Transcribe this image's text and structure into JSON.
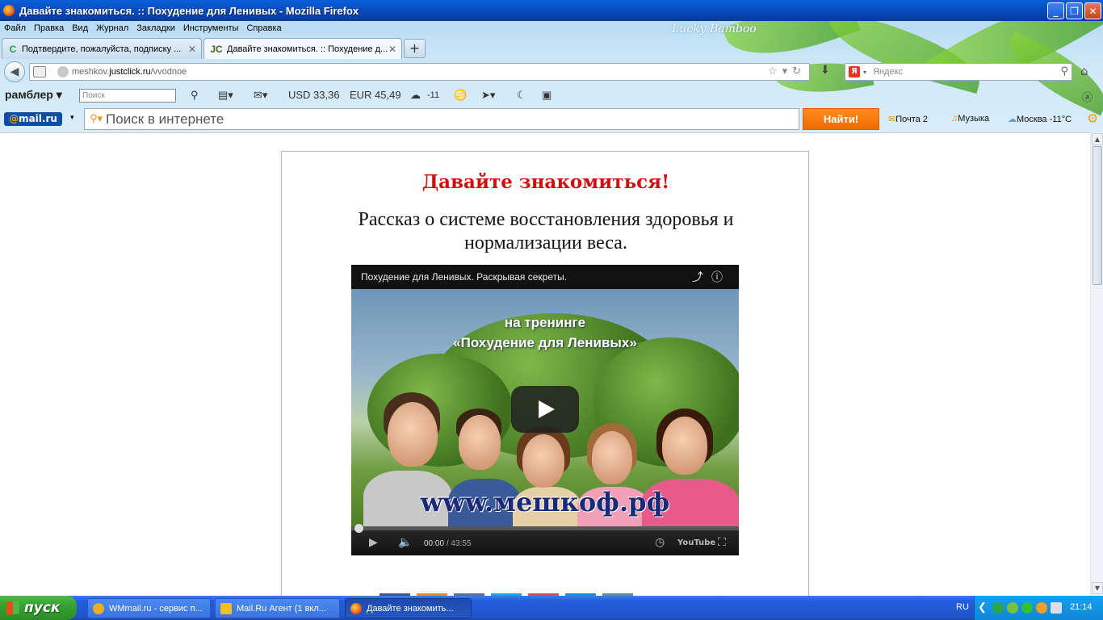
{
  "window": {
    "title": "Давайте знакомиться. :: Похудение для Ленивых - Mozilla Firefox",
    "btn_min": "_",
    "btn_max": "❐",
    "btn_close": "✕"
  },
  "menu": [
    "Файл",
    "Правка",
    "Вид",
    "Журнал",
    "Закладки",
    "Инструменты",
    "Справка"
  ],
  "theme_name": "Lucky Bamboo",
  "tabs": [
    {
      "label": "Подтвердите, пожалуйста, подписку ...",
      "favicon": "C",
      "favicon_color": "#2a9d34"
    },
    {
      "label": "Давайте знакомиться. :: Похудение д...",
      "favicon": "JC",
      "favicon_color": "#3a6a1a"
    }
  ],
  "tab_close_glyph": "✕",
  "new_tab_glyph": "+",
  "nav": {
    "url_prefix": "meshkov.",
    "url_domain": "justclick.ru",
    "url_path": "/vvodnoe",
    "search_placeholder": "Яндекс",
    "yandex_logo": "Я"
  },
  "rambler": {
    "logo": "рамблер ▾",
    "search_placeholder": "Поиск",
    "usd": "USD 33,36",
    "eur": "EUR 45,49",
    "weather": "-11"
  },
  "mailru": {
    "logo_at": "@",
    "logo_text": "mail.ru",
    "search_placeholder": "Поиск в интернете",
    "find_button": "Найти!",
    "mail": "Почта 2",
    "music": "Музыка",
    "weather": "Москва -11°C"
  },
  "page": {
    "heading": "Давайте знакомиться!",
    "subheading": "Рассказ о системе восстановления здоровья и нормализации веса."
  },
  "video": {
    "title": "Похудение для Ленивых. Раскрывая секреты.",
    "overlay_line1": "на тренинге",
    "overlay_line2": "«Похудение для Ленивых»",
    "site": "www.мешкоф.рф",
    "current_time": "00:00",
    "duration": "/ 43:55",
    "progress": 0
  },
  "taskbar": {
    "start": "пуск",
    "buttons": [
      {
        "label": "WMmail.ru - сервис п...",
        "icon_color": "#e8b020"
      },
      {
        "label": "Mail.Ru Агент (1 вкл...",
        "icon_color": "#f0c020"
      },
      {
        "label": "Давайте знакомить...",
        "icon_color": "#e8611a"
      }
    ],
    "lang": "RU",
    "clock": "21:14"
  }
}
